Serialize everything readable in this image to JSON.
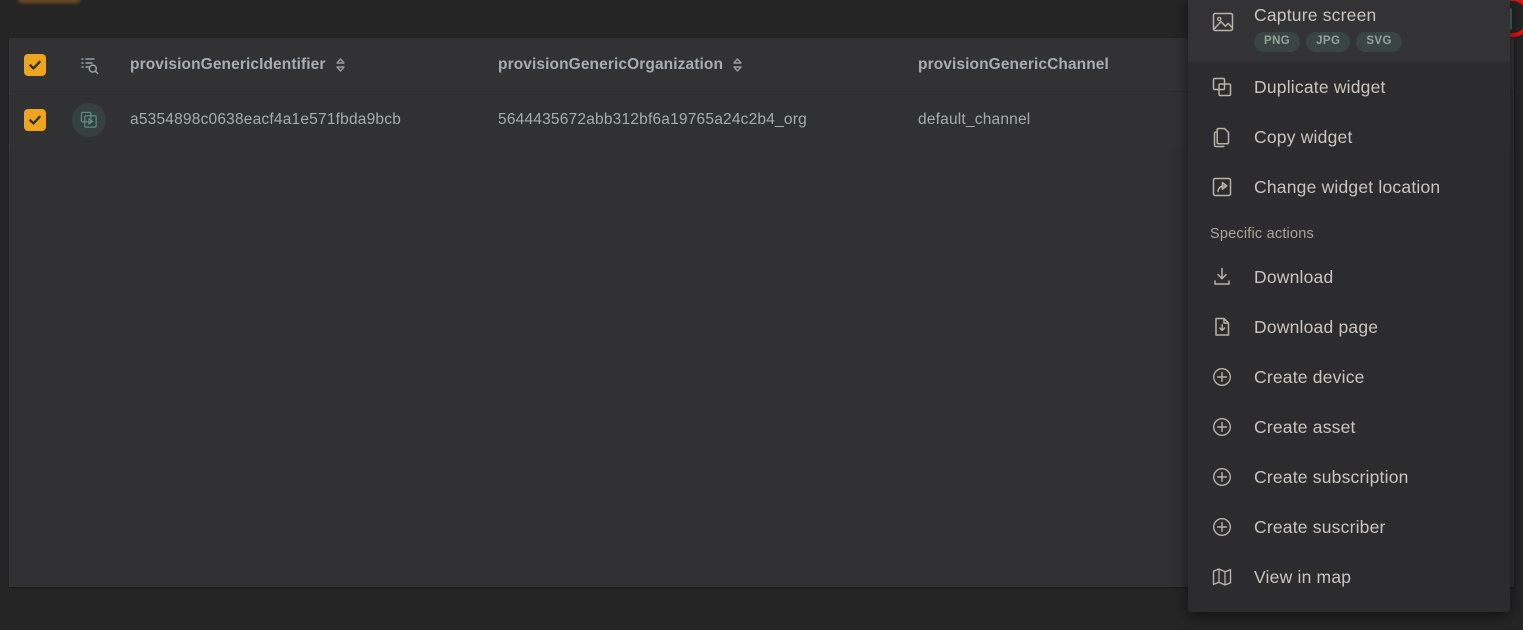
{
  "table": {
    "columns": [
      {
        "key": "identifier",
        "label": "provisionGenericIdentifier",
        "sortable": true
      },
      {
        "key": "organization",
        "label": "provisionGenericOrganization",
        "sortable": true
      },
      {
        "key": "channel",
        "label": "provisionGenericChannel",
        "sortable": false
      }
    ],
    "header": {
      "select_all_checked": true,
      "filter_icon": "list-search-icon"
    },
    "rows": [
      {
        "selected": true,
        "row_icon": "copy-layers-play-icon",
        "identifier": "a5354898c0638eacf4a1e571fbda9bcb",
        "organization": "5644435672abb312bf6a19765a24c2b4_org",
        "channel": "default_channel"
      }
    ]
  },
  "context_menu": {
    "capture": {
      "label": "Capture screen",
      "icon": "image-capture-icon",
      "formats": [
        "PNG",
        "JPG",
        "SVG"
      ]
    },
    "general_items": [
      {
        "label": "Duplicate widget",
        "icon": "duplicate-widget-icon"
      },
      {
        "label": "Copy widget",
        "icon": "copy-widget-icon"
      },
      {
        "label": "Change widget location",
        "icon": "change-location-icon"
      }
    ],
    "section_title": "Specific actions",
    "specific_items": [
      {
        "label": "Download",
        "icon": "download-icon"
      },
      {
        "label": "Download page",
        "icon": "download-page-icon"
      },
      {
        "label": "Create device",
        "icon": "plus-circle-icon"
      },
      {
        "label": "Create asset",
        "icon": "plus-circle-icon"
      },
      {
        "label": "Create subscription",
        "icon": "plus-circle-icon"
      },
      {
        "label": "Create suscriber",
        "icon": "plus-circle-icon"
      },
      {
        "label": "View in map",
        "icon": "map-icon"
      }
    ]
  },
  "colors": {
    "accent_orange": "#eda41e",
    "badge_red": "#e2100f",
    "icon_teal": "#5f8c85",
    "panel_bg": "#303032",
    "menu_bg": "#2c2c2e",
    "page_bg": "#252525"
  }
}
